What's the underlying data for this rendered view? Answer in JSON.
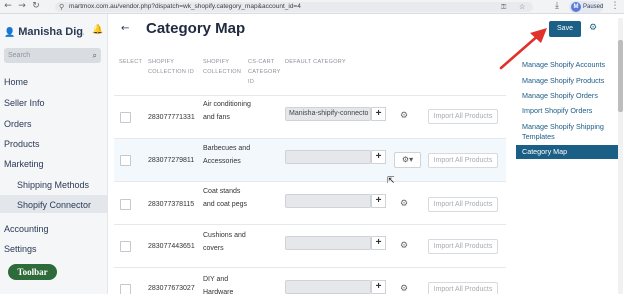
{
  "browser": {
    "url": "martmox.com.au/vendor.php?dispatch=wk_shopify.category_map&account_id=4",
    "profile_label": "Paused",
    "profile_initial": "M"
  },
  "sidebar": {
    "store_name": "Manisha Dig...",
    "search_placeholder": "Search",
    "items": [
      {
        "label": "Home"
      },
      {
        "label": "Seller Info"
      },
      {
        "label": "Orders"
      },
      {
        "label": "Products"
      },
      {
        "label": "Marketing"
      },
      {
        "label": "Shipping Methods"
      },
      {
        "label": "Shopify Connector"
      },
      {
        "label": "Accounting"
      },
      {
        "label": "Settings"
      }
    ],
    "toolbar_label": "Toolbar"
  },
  "page": {
    "title": "Category Map"
  },
  "table": {
    "headers": {
      "select": "SELECT",
      "collection_id": "SHOPIFY COLLECTION ID",
      "collection": "SHOPIFY COLLECTION",
      "cs_cart": "CS-CART CATEGORY ID",
      "default_category": "DEFAULT CATEGORY"
    },
    "rows": [
      {
        "id": "283077771331",
        "name": "Air conditioning and fans",
        "category": "Manisha-shipify-connecto",
        "import": "Import All Products"
      },
      {
        "id": "283077279811",
        "name": "Barbecues and Accessories",
        "category": "",
        "import": "Import All Products"
      },
      {
        "id": "283077378115",
        "name": "Coat stands and coat pegs",
        "category": "",
        "import": "Import All Products"
      },
      {
        "id": "283077443651",
        "name": "Cushions and covers",
        "category": "",
        "import": "Import All Products"
      },
      {
        "id": "283077673027",
        "name": "DIY and Hardware",
        "category": "",
        "import": "Import All Products"
      }
    ]
  },
  "right_panel": {
    "save_label": "Save",
    "links": [
      {
        "label": "Manage Shopify Accounts"
      },
      {
        "label": "Manage Shopify Products"
      },
      {
        "label": "Manage Shopify Orders"
      },
      {
        "label": "Import Shopify Orders"
      },
      {
        "label": "Manage Shopify Shipping Templates"
      },
      {
        "label": "Category Map"
      }
    ]
  },
  "colors": {
    "accent": "#1c5f86",
    "annotation_arrow": "#e0312b",
    "toolbar_badge": "#2f6b3a"
  }
}
